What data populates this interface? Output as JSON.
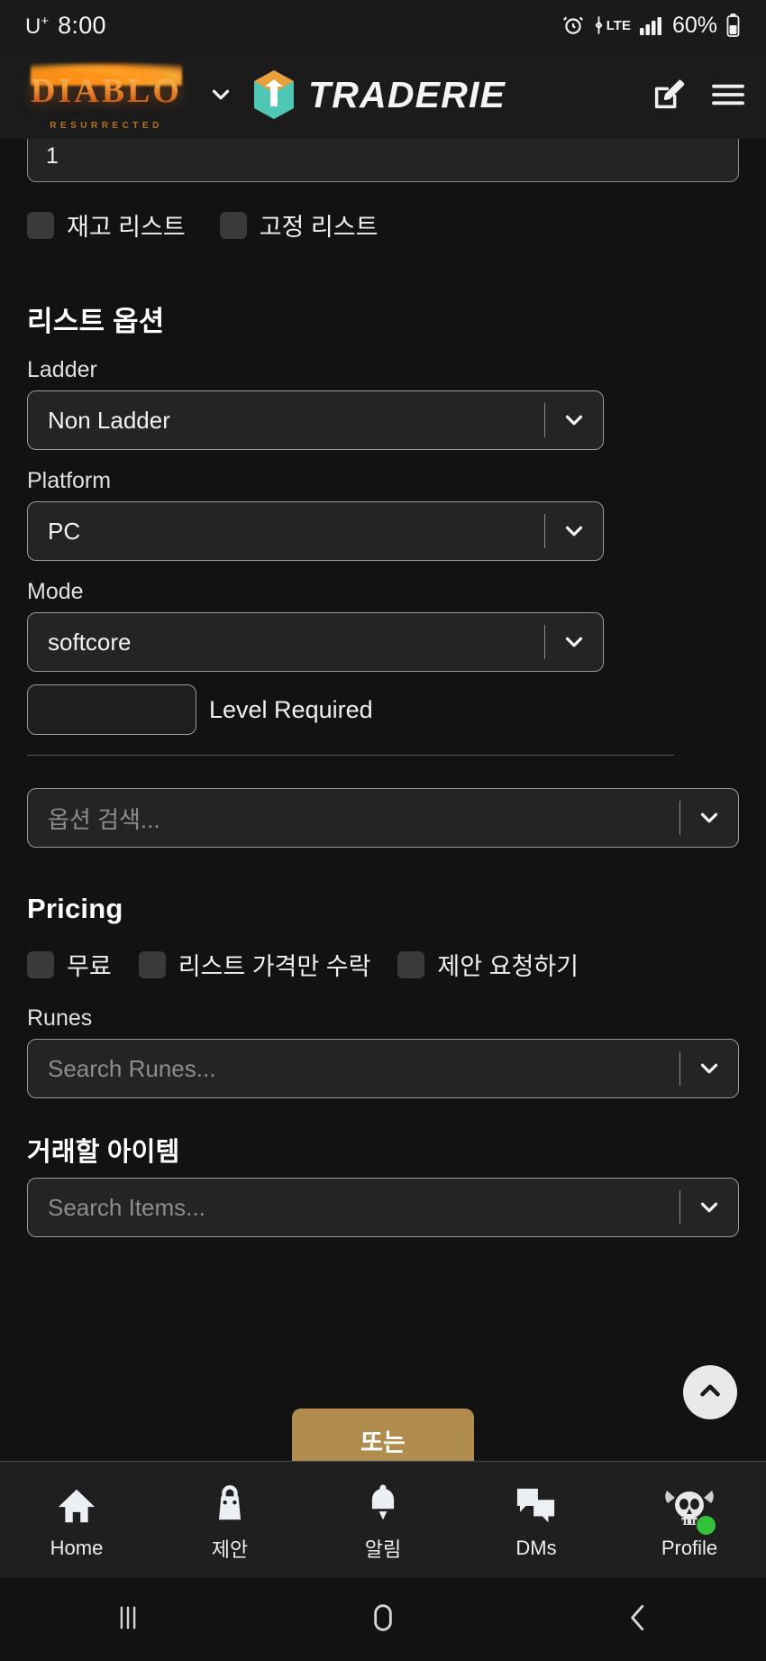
{
  "status_bar": {
    "carrier": "U",
    "carrier_sup": "+",
    "time": "8:00",
    "network_type": "LTE",
    "battery_percent": "60%",
    "alarm_icon": "alarm-icon",
    "signal_icon": "signal-bars-icon",
    "battery_icon": "battery-icon"
  },
  "header": {
    "game_title": "DIABLO",
    "game_subtitle": "RESURRECTED",
    "brand_name": "TRADERIE",
    "game_dropdown_icon": "chevron-down-icon",
    "compose_icon": "compose-icon",
    "menu_icon": "hamburger-menu-icon",
    "brand_colors": {
      "orange": "#e8a13a",
      "teal": "#4ec7b4",
      "cyan": "#3fb6c9"
    }
  },
  "form": {
    "quantity_value": "1",
    "stock_list_label": "재고 리스트",
    "fixed_list_label": "고정 리스트",
    "list_options_title": "리스트 옵션",
    "ladder": {
      "label": "Ladder",
      "value": "Non Ladder",
      "caret_icon": "chevron-down-icon"
    },
    "platform": {
      "label": "Platform",
      "value": "PC",
      "caret_icon": "chevron-down-icon"
    },
    "mode": {
      "label": "Mode",
      "value": "softcore",
      "caret_icon": "chevron-down-icon"
    },
    "level_required": {
      "label": "Level Required",
      "value": ""
    },
    "option_search": {
      "placeholder": "옵션 검색...",
      "caret_icon": "chevron-down-icon"
    }
  },
  "pricing": {
    "title": "Pricing",
    "free_label": "무료",
    "list_price_only_label": "리스트 가격만 수락",
    "request_offer_label": "제안 요청하기",
    "runes": {
      "label": "Runes",
      "placeholder": "Search Runes...",
      "caret_icon": "chevron-down-icon"
    },
    "items": {
      "label": "거래할 아이템",
      "placeholder": "Search Items...",
      "caret_icon": "chevron-down-icon"
    }
  },
  "actions": {
    "or_button_label": "또는",
    "or_button_color": "#b08d4e",
    "scroll_top_icon": "chevron-up-icon"
  },
  "bottom_nav": [
    {
      "label": "Home",
      "icon": "home-icon"
    },
    {
      "label": "제안",
      "icon": "shopping-bag-icon"
    },
    {
      "label": "알림",
      "icon": "bell-icon"
    },
    {
      "label": "DMs",
      "icon": "chat-bubbles-icon"
    },
    {
      "label": "Profile",
      "icon": "skull-avatar-icon",
      "status_color": "#33c33a"
    }
  ],
  "android_nav": [
    {
      "name": "recents",
      "icon": "recents-icon"
    },
    {
      "name": "home",
      "icon": "home-circle-icon"
    },
    {
      "name": "back",
      "icon": "back-chevron-icon"
    }
  ]
}
